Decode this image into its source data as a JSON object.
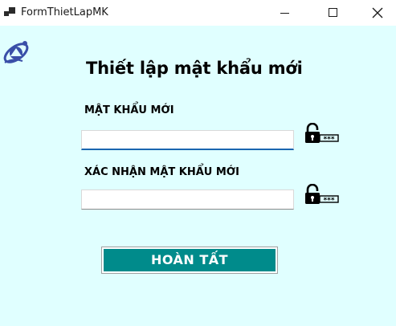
{
  "window": {
    "title": "FormThietLapMK",
    "controls": [
      "minimize-icon",
      "maximize-icon",
      "close-icon"
    ]
  },
  "form": {
    "logo": "university-logo",
    "heading": "Thiết lập mật khẩu mới",
    "new_password": {
      "label": "MẬT KHẨU MỚI",
      "value": "",
      "icon": "lock-password-icon"
    },
    "confirm_password": {
      "label": "XÁC NHẬN MẬT KHẨU MỚI",
      "value": "",
      "icon": "lock-password-icon"
    },
    "submit_label": "HOÀN TẤT"
  },
  "colors": {
    "background": "#e0ffff",
    "button": "#008b8b",
    "button_text": "#ffffff",
    "focus_underline": "#1a66b0"
  }
}
